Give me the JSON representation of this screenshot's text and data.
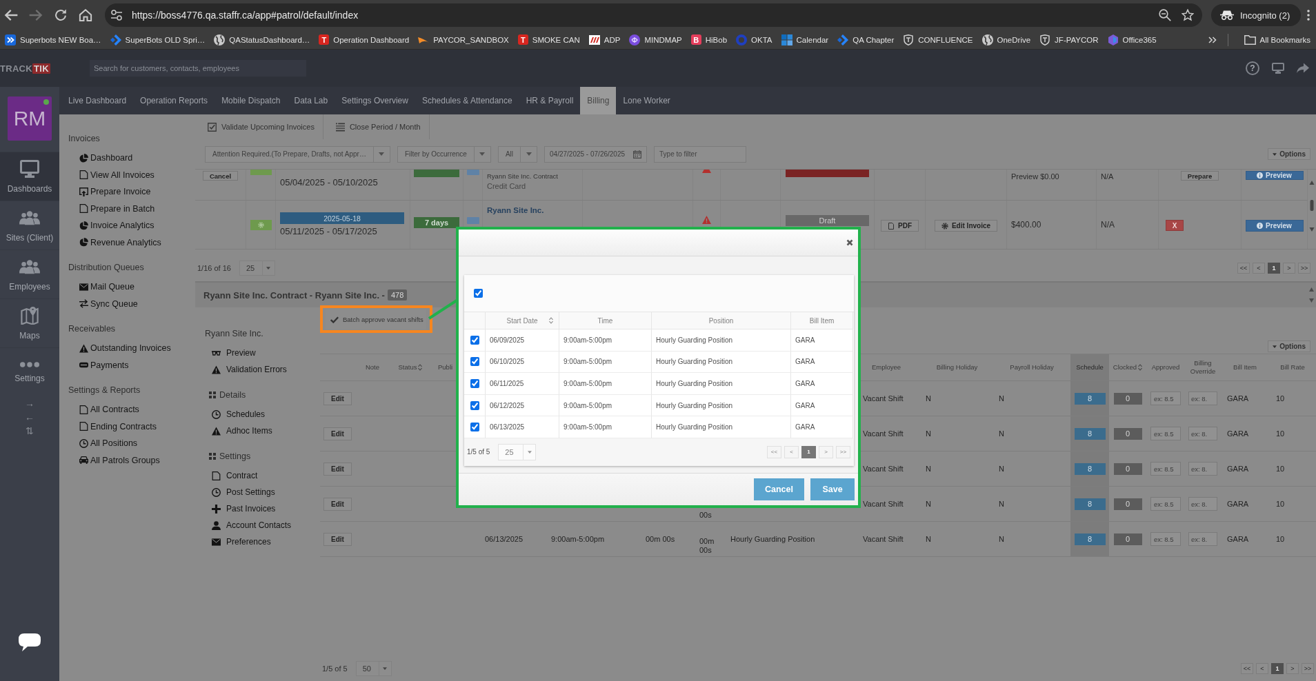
{
  "browser": {
    "url": "https://boss4776.qa.staffr.ca/app#patrol/default/index",
    "profile": "Incognito (2)",
    "bookmarks": [
      {
        "label": "Superbots NEW Boa…",
        "kind": "tile"
      },
      {
        "label": "SuperBots OLD Spri…",
        "kind": "chevrons"
      },
      {
        "label": "QAStatusDashboard…",
        "kind": "globe"
      },
      {
        "label": "Operation Dashboard",
        "kind": "letter",
        "letter": "T"
      },
      {
        "label": "PAYCOR_SANDBOX",
        "kind": "swoosh"
      },
      {
        "label": "SMOKE CAN",
        "kind": "letter",
        "letter": "T"
      },
      {
        "label": "ADP",
        "kind": "stripes"
      },
      {
        "label": "MINDMAP",
        "kind": "swirl"
      },
      {
        "label": "HiBob",
        "kind": "letter",
        "letter": "B"
      },
      {
        "label": "OKTA",
        "kind": "ring"
      },
      {
        "label": "Calendar",
        "kind": "squares"
      },
      {
        "label": "QA Chapter",
        "kind": "chevrons"
      },
      {
        "label": "CONFLUENCE",
        "kind": "shield"
      },
      {
        "label": "OneDrive",
        "kind": "globe"
      },
      {
        "label": "JF-PAYCOR",
        "kind": "shield"
      },
      {
        "label": "Office365",
        "kind": "hexagon"
      }
    ],
    "all_bookmarks": "All Bookmarks"
  },
  "app": {
    "logo": {
      "first": "TRACK",
      "second": "TIK"
    },
    "search_placeholder": "Search for customers, contacts, employees",
    "help": "?",
    "nav": [
      {
        "label": "Live Dashboard",
        "selected": false
      },
      {
        "label": "Operation Reports",
        "selected": false
      },
      {
        "label": "Mobile Dispatch",
        "selected": false
      },
      {
        "label": "Data Lab",
        "selected": false
      },
      {
        "label": "Settings Overview",
        "selected": false
      },
      {
        "label": "Schedules & Attendance",
        "selected": false
      },
      {
        "label": "HR & Payroll",
        "selected": false
      },
      {
        "label": "Billing",
        "selected": true
      },
      {
        "label": "Lone Worker",
        "selected": false
      }
    ],
    "sidebar": {
      "avatar": "RM",
      "online": true,
      "items": [
        {
          "label": "Dashboards",
          "kind": "monitor",
          "selected": true
        },
        {
          "label": "Sites (Client)",
          "kind": "people",
          "selected": false
        },
        {
          "label": "Employees",
          "kind": "people",
          "selected": false
        },
        {
          "label": "Maps",
          "kind": "map",
          "selected": false
        },
        {
          "label": "Settings",
          "kind": "dots",
          "selected": false
        }
      ],
      "arrows": [
        "→",
        "←",
        "⇅"
      ]
    },
    "menu": [
      {
        "title": "Invoices",
        "items": [
          {
            "label": "Dashboard",
            "kind": "pie"
          },
          {
            "label": "View All Invoices",
            "kind": "doc"
          },
          {
            "label": "Prepare Invoice",
            "kind": "doc-arrow"
          },
          {
            "label": "Prepare in Batch",
            "kind": "doc"
          },
          {
            "label": "Invoice Analytics",
            "kind": "segments"
          },
          {
            "label": "Revenue Analytics",
            "kind": "segments"
          }
        ]
      },
      {
        "title": "Distribution Queues",
        "items": [
          {
            "label": "Mail Queue",
            "kind": "envelope"
          },
          {
            "label": "Sync Queue",
            "kind": "swap"
          }
        ]
      },
      {
        "title": "Receivables",
        "items": [
          {
            "label": "Outstanding Invoices",
            "kind": "warning"
          },
          {
            "label": "Payments",
            "kind": "card"
          }
        ]
      },
      {
        "title": "Settings & Reports",
        "items": [
          {
            "label": "All Contracts",
            "kind": "doc"
          },
          {
            "label": "Ending Contracts",
            "kind": "doc"
          },
          {
            "label": "All Positions",
            "kind": "clock"
          },
          {
            "label": "All Patrols Groups",
            "kind": "car"
          }
        ]
      }
    ]
  },
  "invoices": {
    "actions": [
      {
        "label": "Validate Upcoming Invoices",
        "kind": "checkbox"
      },
      {
        "label": "Close Period / Month",
        "kind": "list"
      }
    ],
    "filters": {
      "status": "Attention Required.(To Prepare, Drafts, not Appr…",
      "occurrence": "Filter by Occurrence",
      "scope": "All",
      "date_range": "04/27/2025 - 07/26/2025",
      "search_placeholder": "Type to filter",
      "options": "Options"
    },
    "rows": [
      {
        "kind": "partial",
        "cancel": "Cancel",
        "period": "05/04/2025 - 05/10/2025",
        "contract": "Ryann Site Inc. Contract",
        "payment": "Credit Card",
        "amount": "Preview $0.00",
        "terms": "N/A",
        "prepare": "Prepare",
        "preview": "Preview"
      },
      {
        "kind": "full",
        "due": "2025-05-18",
        "period": "05/11/2025 - 05/17/2025",
        "days": "7 days",
        "site": "Ryann Site Inc.",
        "status": "Draft",
        "pdf": "PDF",
        "edit": "Edit Invoice",
        "amount": "$400.00",
        "terms": "N/A",
        "delete": "X",
        "preview": "Preview"
      }
    ],
    "summary": "1/16 of 16",
    "page_size": "25",
    "pages": [
      {
        "label": "<<",
        "selected": false
      },
      {
        "label": "<",
        "selected": false
      },
      {
        "label": "1",
        "selected": true
      },
      {
        "label": ">",
        "selected": false
      },
      {
        "label": ">>",
        "selected": false
      }
    ]
  },
  "contract": {
    "title": "Ryann Site Inc. Contract - Ryann Site Inc. -",
    "count": "478",
    "batch": "Batch approve vacant shifts",
    "site_menu": {
      "title": "Ryann Site Inc.",
      "items": [
        {
          "label": "Preview",
          "kind": "glasses"
        },
        {
          "label": "Validation Errors",
          "kind": "warning"
        }
      ],
      "groups": [
        {
          "title": "Details",
          "items": [
            {
              "label": "Schedules",
              "kind": "clock"
            },
            {
              "label": "Adhoc Items",
              "kind": "warning"
            }
          ]
        },
        {
          "title": "Settings",
          "items": [
            {
              "label": "Contract",
              "kind": "doc"
            },
            {
              "label": "Post Settings",
              "kind": "clock"
            },
            {
              "label": "Past Invoices",
              "kind": "plus"
            },
            {
              "label": "Account Contacts",
              "kind": "person"
            },
            {
              "label": "Preferences",
              "kind": "envelope"
            }
          ]
        }
      ]
    },
    "shifts": {
      "options": "Options",
      "headers": {
        "note": {
          "label": "Note",
          "sortable": false
        },
        "status": {
          "label": "Status",
          "sortable": true
        },
        "column_4": {
          "label": "Publi",
          "sortable": false
        },
        "employee": {
          "label": "Employee",
          "sortable": false
        },
        "billing_holiday": {
          "label": "Billing Holiday",
          "sortable": false
        },
        "payroll_holiday": {
          "label": "Payroll Holiday",
          "sortable": false
        },
        "schedule": {
          "label": "Schedule",
          "sortable": false
        },
        "clocked": {
          "label": "Clocked",
          "sortable": true
        },
        "approved": {
          "label": "Approved",
          "sortable": false
        },
        "billing_override": {
          "label": "Billing Override",
          "sortable": false
        },
        "bill_item": {
          "label": "Bill Item",
          "sortable": false
        },
        "bill_rate": {
          "label": "Bill Rate",
          "sortable": false
        }
      },
      "rows": [
        {
          "column_1": "Edit",
          "employee": "Vacant Shift",
          "billing_holiday": "N",
          "payroll_holiday": "N",
          "schedule": "8",
          "clocked": "0",
          "approved": {
            "placeholder": "ex: 8.5"
          },
          "billing_override": {
            "placeholder": "ex: 8."
          },
          "bill_item": "GARA",
          "bill_rate": "10"
        },
        {
          "column_1": "Edit",
          "employee": "Vacant Shift",
          "billing_holiday": "N",
          "payroll_holiday": "N",
          "schedule": "8",
          "clocked": "0",
          "approved": {
            "placeholder": "ex: 8.5"
          },
          "billing_override": {
            "placeholder": "ex: 8."
          },
          "bill_item": "GARA",
          "bill_rate": "10"
        },
        {
          "column_1": "Edit",
          "employee": "Vacant Shift",
          "billing_holiday": "N",
          "payroll_holiday": "N",
          "schedule": "8",
          "clocked": "0",
          "approved": {
            "placeholder": "ex: 8.5"
          },
          "billing_override": {
            "placeholder": "ex: 8."
          },
          "bill_item": "GARA",
          "bill_rate": "10"
        },
        {
          "column_1": "Edit",
          "column_8": "00s",
          "employee": "Vacant Shift",
          "billing_holiday": "N",
          "payroll_holiday": "N",
          "schedule": "8",
          "clocked": "0",
          "approved": {
            "placeholder": "ex: 8.5"
          },
          "billing_override": {
            "placeholder": "ex: 8."
          },
          "bill_item": "GARA",
          "bill_rate": "10"
        },
        {
          "column_1": "Edit",
          "column_5": "06/13/2025",
          "column_6": "9:00am-5:00pm",
          "column_7": "00m 00s",
          "column_8": "00m 00s",
          "column_9": "Hourly Guarding Position",
          "employee": "Vacant Shift",
          "billing_holiday": "N",
          "payroll_holiday": "N",
          "schedule": "8",
          "clocked": "0",
          "approved": {
            "placeholder": "ex: 8.5"
          },
          "billing_override": {
            "placeholder": "ex: 8."
          },
          "bill_item": "GARA",
          "bill_rate": "10"
        }
      ],
      "summary": "1/5 of 5",
      "page_size": "50",
      "pages": [
        {
          "label": "<<",
          "selected": false
        },
        {
          "label": "<",
          "selected": false
        },
        {
          "label": "1",
          "selected": true
        },
        {
          "label": ">",
          "selected": false
        },
        {
          "label": ">>",
          "selected": false
        }
      ]
    }
  },
  "modal": {
    "select_all": true,
    "columns": [
      {
        "label": "Start Date",
        "sortable": true
      },
      {
        "label": "Time",
        "sortable": false
      },
      {
        "label": "Position",
        "sortable": false
      },
      {
        "label": "Bill Item",
        "sortable": false
      }
    ],
    "rows": [
      {
        "checked": true,
        "cells": [
          "06/09/2025",
          "9:00am-5:00pm",
          "Hourly Guarding Position",
          "GARA"
        ]
      },
      {
        "checked": true,
        "cells": [
          "06/10/2025",
          "9:00am-5:00pm",
          "Hourly Guarding Position",
          "GARA"
        ]
      },
      {
        "checked": true,
        "cells": [
          "06/11/2025",
          "9:00am-5:00pm",
          "Hourly Guarding Position",
          "GARA"
        ]
      },
      {
        "checked": true,
        "cells": [
          "06/12/2025",
          "9:00am-5:00pm",
          "Hourly Guarding Position",
          "GARA"
        ]
      },
      {
        "checked": true,
        "cells": [
          "06/13/2025",
          "9:00am-5:00pm",
          "Hourly Guarding Position",
          "GARA"
        ]
      }
    ],
    "summary": "1/5 of 5",
    "page_size": "25",
    "pages": [
      {
        "label": "<<",
        "selected": false
      },
      {
        "label": "<",
        "selected": false
      },
      {
        "label": "1",
        "selected": true
      },
      {
        "label": ">",
        "selected": false
      },
      {
        "label": ">>",
        "selected": false
      }
    ],
    "buttons": [
      {
        "label": "Cancel"
      },
      {
        "label": "Save"
      }
    ]
  }
}
